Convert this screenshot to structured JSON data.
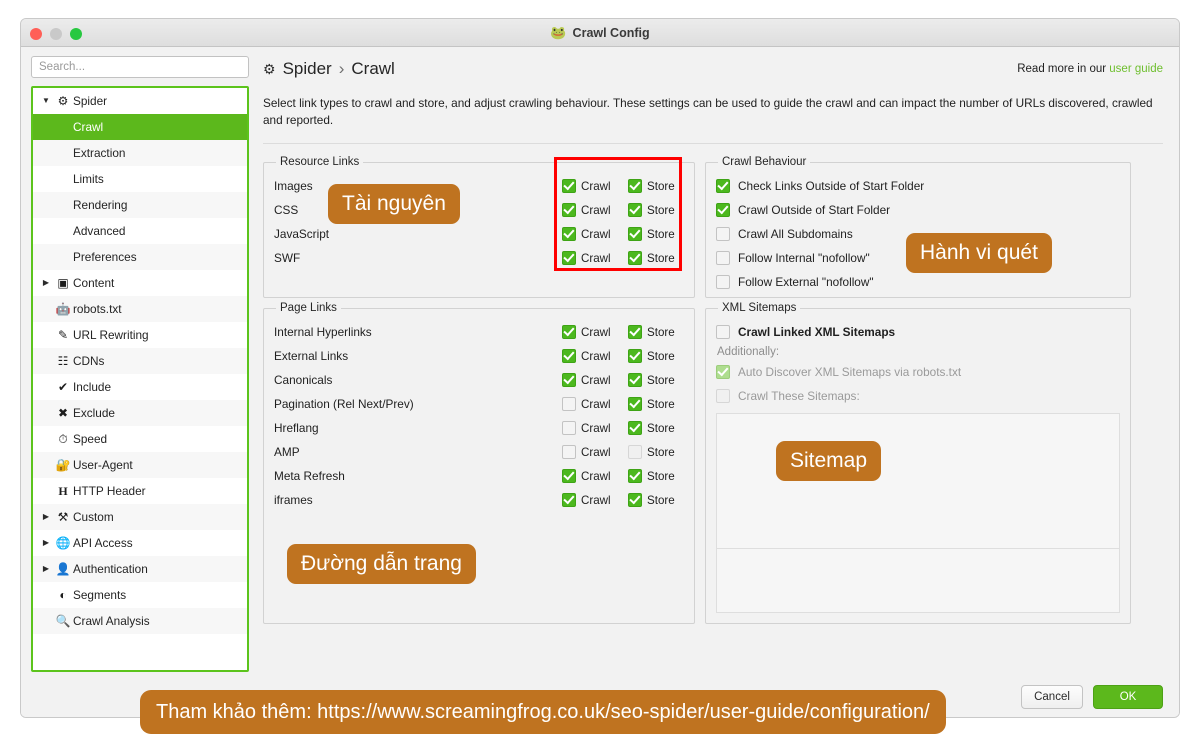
{
  "window": {
    "title": "Crawl Config",
    "title_icon": "frog-icon",
    "traffic_lights": [
      "close",
      "minimize",
      "zoom"
    ]
  },
  "sidebar": {
    "search": {
      "placeholder": "Search...",
      "value": ""
    },
    "items": [
      {
        "label": "Spider",
        "level": 1,
        "icon": "gear-icon",
        "arrow": "▼",
        "selected": false
      },
      {
        "label": "Crawl",
        "level": 2,
        "icon": "",
        "arrow": "",
        "selected": true
      },
      {
        "label": "Extraction",
        "level": 2,
        "icon": "",
        "arrow": "",
        "selected": false
      },
      {
        "label": "Limits",
        "level": 2,
        "icon": "",
        "arrow": "",
        "selected": false
      },
      {
        "label": "Rendering",
        "level": 2,
        "icon": "",
        "arrow": "",
        "selected": false
      },
      {
        "label": "Advanced",
        "level": 2,
        "icon": "",
        "arrow": "",
        "selected": false
      },
      {
        "label": "Preferences",
        "level": 2,
        "icon": "",
        "arrow": "",
        "selected": false
      },
      {
        "label": "Content",
        "level": 1,
        "icon": "columns-icon",
        "arrow": "▶",
        "selected": false
      },
      {
        "label": "robots.txt",
        "level": 1,
        "icon": "robot-icon",
        "arrow": "",
        "selected": false
      },
      {
        "label": "URL Rewriting",
        "level": 1,
        "icon": "pencil-square-icon",
        "arrow": "",
        "selected": false
      },
      {
        "label": "CDNs",
        "level": 1,
        "icon": "network-icon",
        "arrow": "",
        "selected": false
      },
      {
        "label": "Include",
        "level": 1,
        "icon": "check-circle-icon",
        "arrow": "",
        "selected": false
      },
      {
        "label": "Exclude",
        "level": 1,
        "icon": "x-circle-icon",
        "arrow": "",
        "selected": false
      },
      {
        "label": "Speed",
        "level": 1,
        "icon": "gauge-icon",
        "arrow": "",
        "selected": false
      },
      {
        "label": "User-Agent",
        "level": 1,
        "icon": "user-agent-icon",
        "arrow": "",
        "selected": false
      },
      {
        "label": "HTTP Header",
        "level": 1,
        "icon": "letter-h-icon",
        "arrow": "",
        "selected": false
      },
      {
        "label": "Custom",
        "level": 1,
        "icon": "tools-icon",
        "arrow": "▶",
        "selected": false
      },
      {
        "label": "API Access",
        "level": 1,
        "icon": "globe-icon",
        "arrow": "▶",
        "selected": false
      },
      {
        "label": "Authentication",
        "level": 1,
        "icon": "user-lock-icon",
        "arrow": "▶",
        "selected": false
      },
      {
        "label": "Segments",
        "level": 1,
        "icon": "pie-chart-icon",
        "arrow": "",
        "selected": false
      },
      {
        "label": "Crawl Analysis",
        "level": 1,
        "icon": "magnifier-icon",
        "arrow": "",
        "selected": false
      }
    ]
  },
  "header": {
    "gear_icon": "gear-icon",
    "breadcrumb_root": "Spider",
    "breadcrumb_sep": "›",
    "breadcrumb_current": "Crawl",
    "read_more_text": "Read more in our",
    "read_more_link": "user guide",
    "description": "Select link types to crawl and store, and adjust crawling behaviour. These settings can be used to guide the crawl and can impact the number of URLs discovered, crawled and reported."
  },
  "panels": {
    "resource_links": {
      "legend": "Resource Links",
      "crawl_label": "Crawl",
      "store_label": "Store",
      "rows": [
        {
          "name": "Images",
          "crawl": true,
          "store": true
        },
        {
          "name": "CSS",
          "crawl": true,
          "store": true
        },
        {
          "name": "JavaScript",
          "crawl": true,
          "store": true
        },
        {
          "name": "SWF",
          "crawl": true,
          "store": true
        }
      ]
    },
    "crawl_behaviour": {
      "legend": "Crawl Behaviour",
      "rows": [
        {
          "label": "Check Links Outside of Start Folder",
          "checked": true
        },
        {
          "label": "Crawl Outside of Start Folder",
          "checked": true
        },
        {
          "label": "Crawl All Subdomains",
          "checked": false
        },
        {
          "label": "Follow Internal \"nofollow\"",
          "checked": false
        },
        {
          "label": "Follow External \"nofollow\"",
          "checked": false
        }
      ]
    },
    "page_links": {
      "legend": "Page Links",
      "crawl_label": "Crawl",
      "store_label": "Store",
      "rows": [
        {
          "name": "Internal Hyperlinks",
          "crawl": true,
          "store": true
        },
        {
          "name": "External Links",
          "crawl": true,
          "store": true
        },
        {
          "name": "Canonicals",
          "crawl": true,
          "store": true
        },
        {
          "name": "Pagination (Rel Next/Prev)",
          "crawl": false,
          "store": true
        },
        {
          "name": "Hreflang",
          "crawl": false,
          "store": true
        },
        {
          "name": "AMP",
          "crawl": false,
          "store": false
        },
        {
          "name": "Meta Refresh",
          "crawl": true,
          "store": true
        },
        {
          "name": "iframes",
          "crawl": true,
          "store": true
        }
      ]
    },
    "xml_sitemaps": {
      "legend": "XML Sitemaps",
      "crawl_linked_label": "Crawl Linked XML Sitemaps",
      "crawl_linked_checked": false,
      "additionally_label": "Additionally:",
      "auto_discover_label": "Auto Discover XML Sitemaps via robots.txt",
      "auto_discover_checked": true,
      "crawl_these_label": "Crawl These Sitemaps:",
      "crawl_these_checked": false,
      "sitemap_list": []
    }
  },
  "footer": {
    "cancel_label": "Cancel",
    "ok_label": "OK"
  },
  "annotations": {
    "badge_resource": "Tài nguyên",
    "badge_behaviour": "Hành vi quét",
    "badge_pagelinks": "Đường dẫn trang",
    "badge_sitemap": "Sitemap",
    "banner": "Tham khảo thêm: https://www.screamingfrog.co.uk/seo-spider/user-guide/configuration/"
  },
  "colors": {
    "accent_green": "#5cb81c",
    "checkbox_green": "#4cb81e",
    "badge_orange": "#bf7320",
    "highlight_red": "#ff0000",
    "link_green": "#6fbf2f"
  }
}
